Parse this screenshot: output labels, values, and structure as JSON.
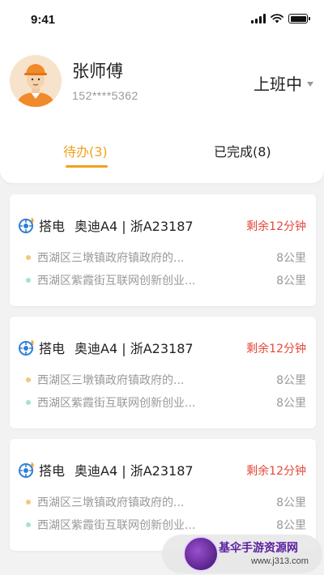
{
  "status_bar": {
    "time": "9:41"
  },
  "profile": {
    "name": "张师傅",
    "phone": "152****5362",
    "work_status": "上班中"
  },
  "tabs": [
    {
      "label": "待办(3)",
      "active": true
    },
    {
      "label": "已完成(8)",
      "active": false
    }
  ],
  "tasks": [
    {
      "type": "搭电",
      "car": "奥迪A4 | 浙A23187",
      "time_left": "剩余12分钟",
      "from": {
        "address": "西湖区三墩镇政府镇政府的...",
        "distance": "8公里"
      },
      "to": {
        "address": "西湖区紫霞街互联网创新创业...",
        "distance": "8公里"
      }
    },
    {
      "type": "搭电",
      "car": "奥迪A4 | 浙A23187",
      "time_left": "剩余12分钟",
      "from": {
        "address": "西湖区三墩镇政府镇政府的...",
        "distance": "8公里"
      },
      "to": {
        "address": "西湖区紫霞街互联网创新创业...",
        "distance": "8公里"
      }
    },
    {
      "type": "搭电",
      "car": "奥迪A4 | 浙A23187",
      "time_left": "剩余12分钟",
      "from": {
        "address": "西湖区三墩镇政府镇政府的...",
        "distance": "8公里"
      },
      "to": {
        "address": "西湖区紫霞街互联网创新创业...",
        "distance": "8公里"
      }
    }
  ],
  "watermark": {
    "title": "基伞手游资源网",
    "url": "www.j313.com"
  },
  "colors": {
    "accent": "#f0a020",
    "warning": "#e5483a",
    "from_dot": "#f5c77a",
    "to_dot": "#a8e0d2"
  }
}
